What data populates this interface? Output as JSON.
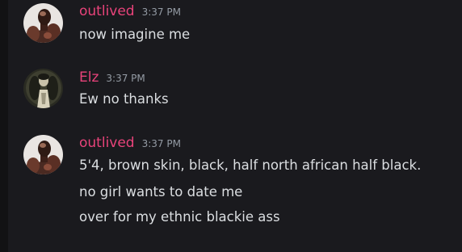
{
  "colors": {
    "background": "#1a1a1e",
    "username": "#e8437a",
    "timestamp": "#949ba4",
    "message_text": "#dbdee1"
  },
  "messages": [
    {
      "author": "outlived",
      "timestamp": "3:37 PM",
      "avatar_icon": "muscular-man-avatar-icon",
      "lines": [
        "now imagine me"
      ]
    },
    {
      "author": "Elz",
      "timestamp": "3:37 PM",
      "avatar_icon": "gothic-statue-avatar-icon",
      "lines": [
        "Ew no thanks"
      ]
    },
    {
      "author": "outlived",
      "timestamp": "3:37 PM",
      "avatar_icon": "muscular-man-avatar-icon",
      "lines": [
        "5'4, brown skin, black, half north african half black.",
        "no girl wants to date me",
        "over for my ethnic blackie ass"
      ]
    }
  ]
}
